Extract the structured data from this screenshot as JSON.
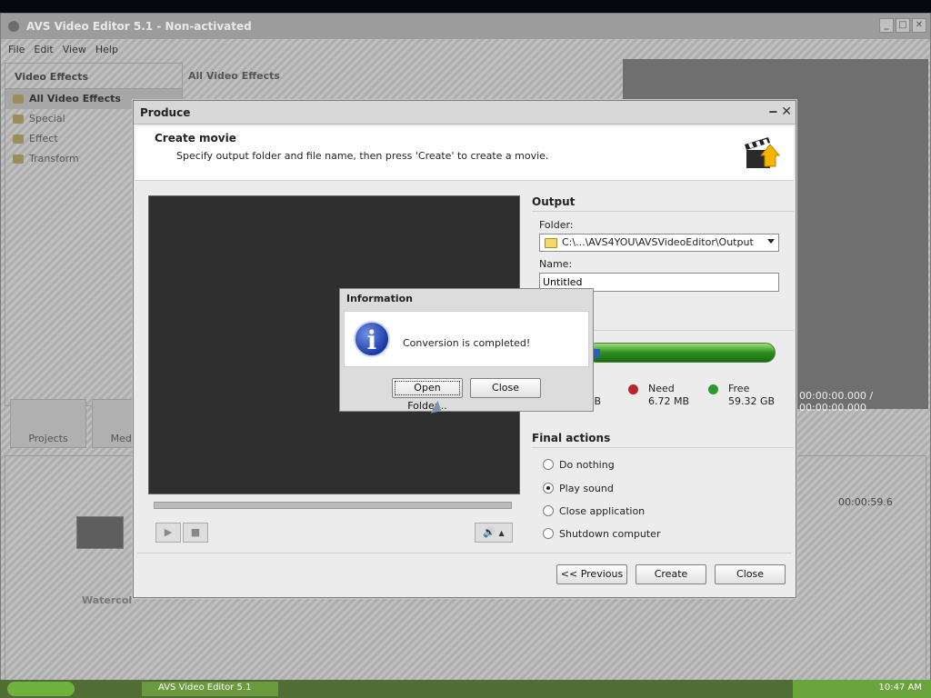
{
  "app": {
    "title": "AVS Video Editor 5.1 - Non-activated",
    "menu": [
      "File",
      "Edit",
      "View",
      "Help"
    ],
    "left_pane": {
      "header": "Video Effects",
      "items": [
        "All Video Effects",
        "Special",
        "Effect",
        "Transform"
      ]
    },
    "mid_pane": {
      "header": "All Video Effects"
    },
    "timecode": "00:00:00.000 / 00:00:00.000",
    "buttons": {
      "projects": "Projects",
      "media": "Media L"
    },
    "timeline": {
      "time": "00:00:59.6",
      "track_label": "Watercol"
    }
  },
  "produce": {
    "title": "Produce",
    "heading": "Create movie",
    "description": "Specify output folder and file name, then press 'Create' to create a movie.",
    "output": {
      "section": "Output",
      "folder_label": "Folder:",
      "folder_value": "C:\\...\\AVS4YOU\\AVSVideoEditor\\Output",
      "name_label": "Name:",
      "name_value": "Untitled"
    },
    "disk": {
      "used_size": "GB",
      "need_label": "Need",
      "need_size": "6.72 MB",
      "free_label": "Free",
      "free_size": "59.32 GB",
      "colors": {
        "need": "#b8262a",
        "free": "#2c9a2a"
      }
    },
    "final_actions": {
      "section": "Final actions",
      "options": [
        "Do nothing",
        "Play sound",
        "Close application",
        "Shutdown computer"
      ],
      "selected": "Play sound"
    },
    "buttons": {
      "previous": "<< Previous",
      "create": "Create",
      "close": "Close"
    }
  },
  "info_dialog": {
    "title": "Information",
    "message": "Conversion is completed!",
    "buttons": {
      "open_folder": "Open Folder...",
      "close": "Close"
    }
  },
  "taskbar": {
    "task": "AVS Video Editor 5.1 ...",
    "clock": "10:47 AM"
  }
}
